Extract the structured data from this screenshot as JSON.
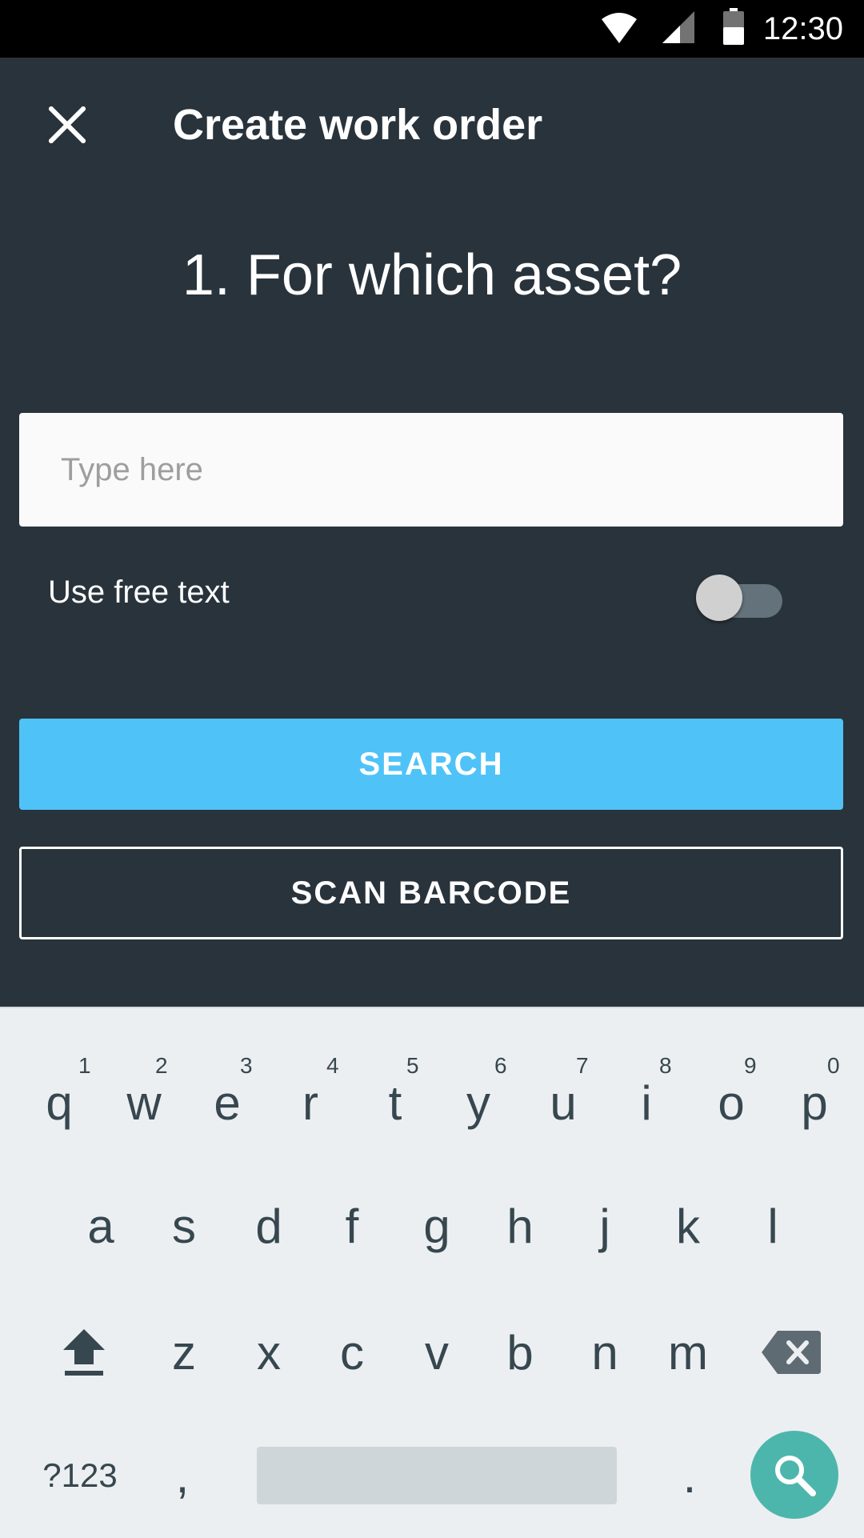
{
  "status_bar": {
    "time": "12:30",
    "icons": [
      "wifi-icon",
      "signal-icon",
      "battery-icon"
    ]
  },
  "header": {
    "close_icon": "close-icon",
    "title": "Create work order"
  },
  "question": "1. For which asset?",
  "search": {
    "placeholder": "Type here",
    "value": ""
  },
  "free_text": {
    "label": "Use free text",
    "enabled": false
  },
  "buttons": {
    "search": "SEARCH",
    "scan_barcode": "SCAN BARCODE"
  },
  "colors": {
    "background": "#29333b",
    "accent": "#4fc3f7",
    "keyboard_action": "#4db6ac"
  },
  "keyboard": {
    "row1": [
      "q",
      "w",
      "e",
      "r",
      "t",
      "y",
      "u",
      "i",
      "o",
      "p"
    ],
    "row1_hints": [
      "1",
      "2",
      "3",
      "4",
      "5",
      "6",
      "7",
      "8",
      "9",
      "0"
    ],
    "row2": [
      "a",
      "s",
      "d",
      "f",
      "g",
      "h",
      "j",
      "k",
      "l"
    ],
    "row3": [
      "z",
      "x",
      "c",
      "v",
      "b",
      "n",
      "m"
    ],
    "symbols_key": "?123",
    "comma": ",",
    "period": ".",
    "shift_icon": "shift-arrow-icon",
    "backspace_icon": "backspace-icon",
    "action_icon": "search-icon"
  }
}
